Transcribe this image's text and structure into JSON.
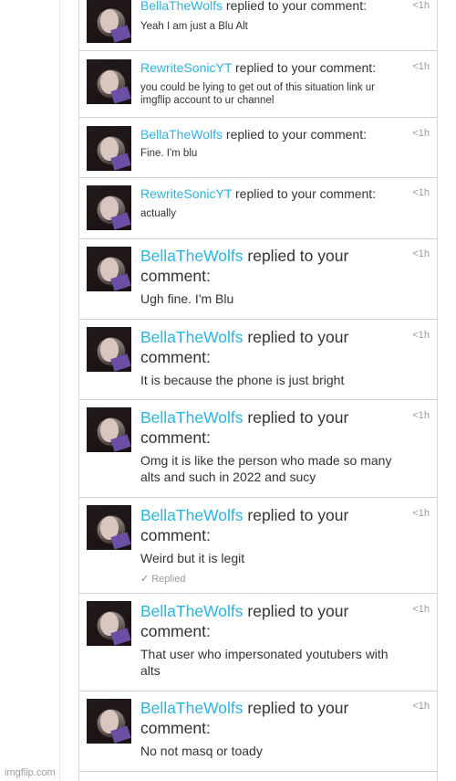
{
  "notifications": [
    {
      "user": "BellaTheWolfs",
      "action": "replied to your comment:",
      "message": "Yeah I am just a Blu Alt",
      "time": "<1h"
    },
    {
      "user": "RewriteSonicYT",
      "action": "replied to your comment:",
      "message": "you could be lying to get out of this situation link ur imgflip account to ur channel",
      "time": "<1h"
    },
    {
      "user": "BellaTheWolfs",
      "action": "replied to your comment:",
      "message": "Fine. I'm blu",
      "time": "<1h"
    },
    {
      "user": "RewriteSonicYT",
      "action": "replied to your comment:",
      "message": "actually",
      "time": "<1h"
    },
    {
      "user": "BellaTheWolfs",
      "action": "replied to your comment:",
      "message": "Ugh fine. I'm Blu",
      "time": "<1h"
    },
    {
      "user": "BellaTheWolfs",
      "action": "replied to your comment:",
      "message": "It is because the phone is just bright",
      "time": "<1h"
    },
    {
      "user": "BellaTheWolfs",
      "action": "replied to your comment:",
      "message": "Omg it is like the person who made so many alts and such in 2022 and sucy",
      "time": "<1h"
    },
    {
      "user": "BellaTheWolfs",
      "action": "replied to your comment:",
      "message": "Weird but it is legit",
      "time": "<1h",
      "status": "Replied"
    },
    {
      "user": "BellaTheWolfs",
      "action": "replied to your comment:",
      "message": "That user who impersonated youtubers with alts",
      "time": "<1h"
    },
    {
      "user": "BellaTheWolfs",
      "action": "replied to your comment:",
      "message": "No not masq or toady",
      "time": "<1h"
    }
  ],
  "watermark": "imgflip.com"
}
